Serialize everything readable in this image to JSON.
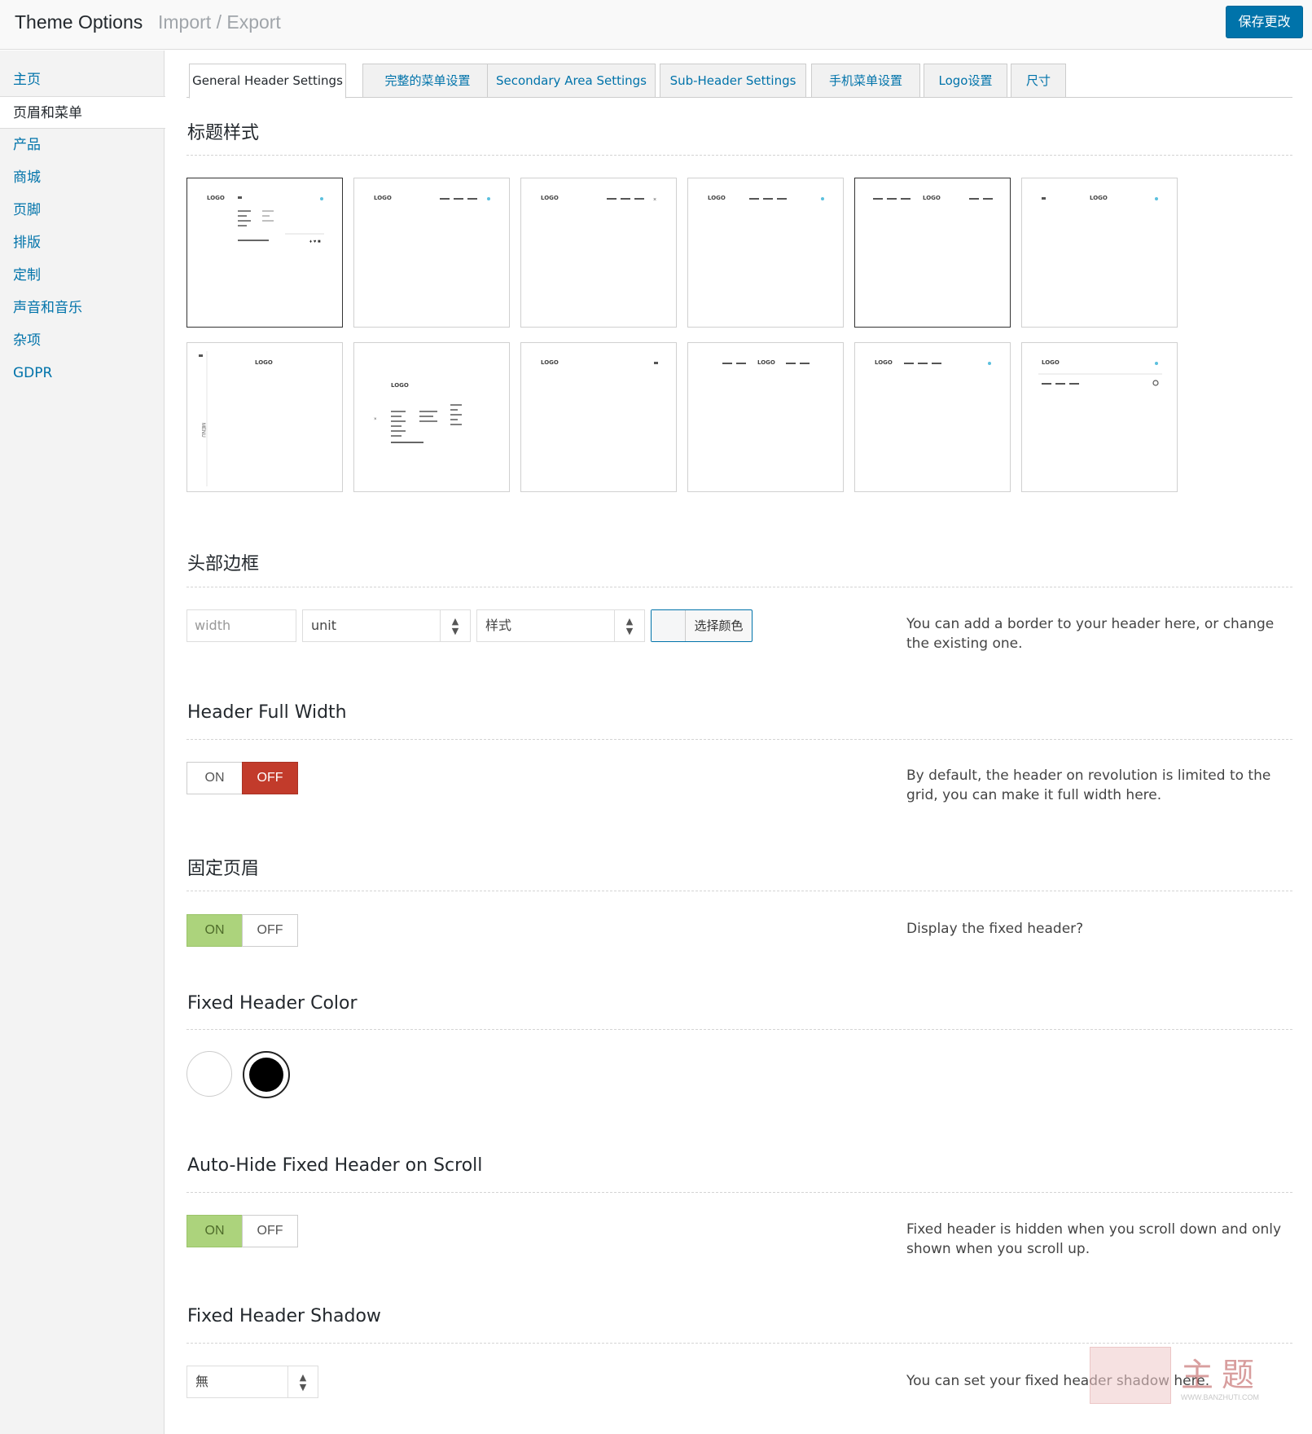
{
  "header": {
    "title": "Theme Options",
    "subtitle": "Import / Export",
    "save_label": "保存更改"
  },
  "sidebar": {
    "items": [
      {
        "label": "主页"
      },
      {
        "label": "页眉和菜单"
      },
      {
        "label": "产品"
      },
      {
        "label": "商城"
      },
      {
        "label": "页脚"
      },
      {
        "label": "排版"
      },
      {
        "label": "定制"
      },
      {
        "label": "声音和音乐"
      },
      {
        "label": "杂项"
      },
      {
        "label": "GDPR"
      }
    ],
    "active_index": 1
  },
  "tabs": [
    {
      "label": "General Header Settings"
    },
    {
      "label": "完整的菜单设置"
    },
    {
      "label": "Secondary Area Settings"
    },
    {
      "label": "Sub-Header Settings"
    },
    {
      "label": "手机菜单设置"
    },
    {
      "label": "Logo设置"
    },
    {
      "label": "尺寸"
    }
  ],
  "sections": {
    "header_style": {
      "title": "标题样式",
      "logo_text": "LOGO",
      "menu_text": "MENU"
    },
    "header_border": {
      "title": "头部边框",
      "width_placeholder": "width",
      "unit_value": "unit",
      "style_value": "样式",
      "color_button": "选择颜色",
      "description": "You can add a border to your header here, or change the existing one."
    },
    "header_full_width": {
      "title": "Header Full Width",
      "on": "ON",
      "off": "OFF",
      "state": "off",
      "description": "By default, the header on revolution is limited to the grid, you can make it full width here."
    },
    "fixed_header": {
      "title": "固定页眉",
      "on": "ON",
      "off": "OFF",
      "state": "on",
      "description": "Display the fixed header?"
    },
    "fixed_header_color": {
      "title": "Fixed Header Color",
      "options": [
        "#ffffff",
        "#000000"
      ],
      "selected": "#000000"
    },
    "auto_hide": {
      "title": "Auto-Hide Fixed Header on Scroll",
      "on": "ON",
      "off": "OFF",
      "state": "on",
      "description": "Fixed header is hidden when you scroll down and only shown when you scroll up."
    },
    "fixed_header_shadow": {
      "title": "Fixed Header Shadow",
      "value": "無",
      "description": "You can set your fixed header shadow here."
    }
  },
  "watermark": {
    "text": "主题",
    "url": "WWW.BANZHUTI.COM"
  },
  "colors": {
    "accent": "#0073aa",
    "toggle_on": "#acd37c",
    "toggle_off_active": "#c23b2b",
    "thumb_dot": "#5bc0de"
  }
}
